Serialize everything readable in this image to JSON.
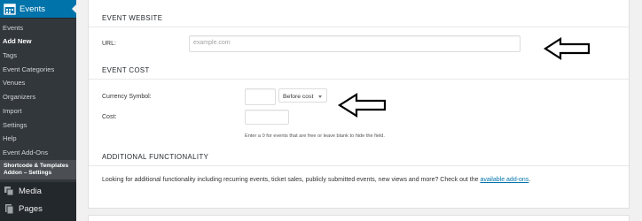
{
  "sidebar": {
    "menu_head": "Events",
    "items": [
      {
        "label": "Events",
        "current": false
      },
      {
        "label": "Add New",
        "current": true
      },
      {
        "label": "Tags",
        "current": false
      },
      {
        "label": "Event Categories",
        "current": false
      },
      {
        "label": "Venues",
        "current": false
      },
      {
        "label": "Organizers",
        "current": false
      },
      {
        "label": "Import",
        "current": false
      },
      {
        "label": "Settings",
        "current": false
      },
      {
        "label": "Help",
        "current": false
      },
      {
        "label": "Event Add-Ons",
        "current": false
      }
    ],
    "addon_item": "Shortcode & Templates Addon – Settings",
    "media": "Media",
    "pages": "Pages"
  },
  "event_website": {
    "title": "EVENT WEBSITE",
    "url_label": "URL:",
    "url_placeholder": "example.com",
    "url_value": ""
  },
  "event_cost": {
    "title": "EVENT COST",
    "currency_label": "Currency Symbol:",
    "currency_value": "",
    "position_select": "Before cost",
    "cost_label": "Cost:",
    "cost_value": "",
    "hint": "Enter a 0 for events that are free or leave blank to hide the field."
  },
  "additional": {
    "title": "ADDITIONAL FUNCTIONALITY",
    "text": "Looking for additional functionality including recurring events, ticket sales, publicly submitted events, new views and more? Check out the ",
    "link": "available add-ons",
    "suffix": "."
  },
  "colors": {
    "sidebar_bg": "#23282d",
    "active_menu": "#0073aa",
    "link": "#0073aa"
  }
}
